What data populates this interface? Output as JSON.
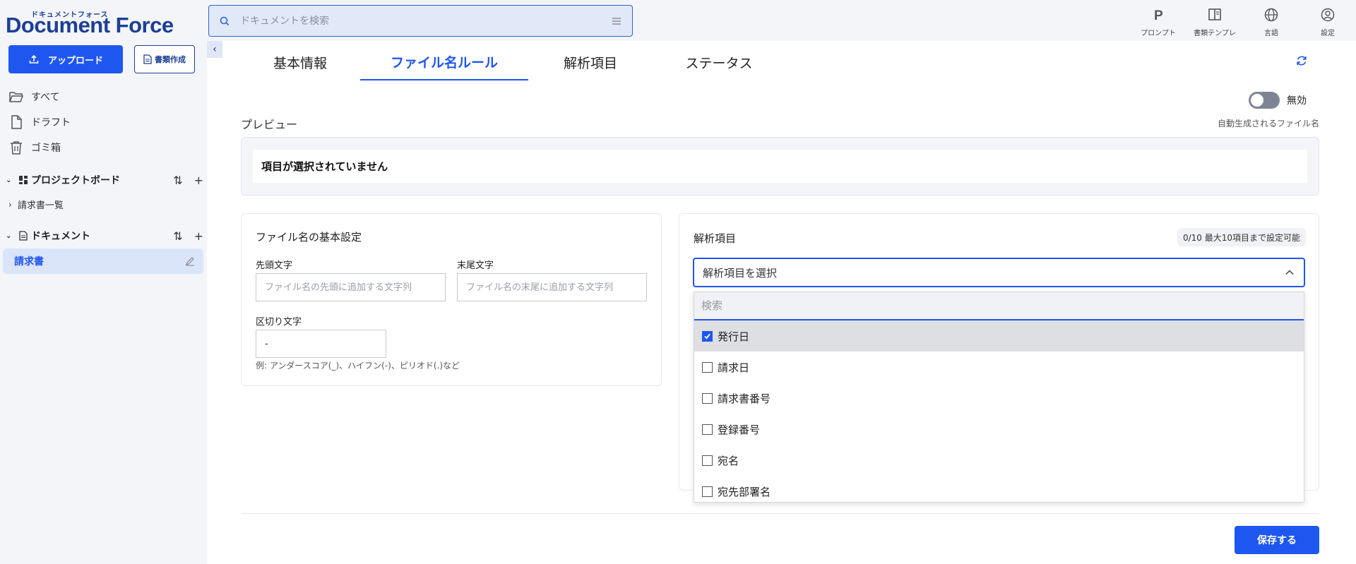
{
  "brand": {
    "sub": "ドキュメントフォース",
    "name": "Document Force",
    "color": "#1d3f95"
  },
  "search": {
    "placeholder": "ドキュメントを検索"
  },
  "top_nav": [
    {
      "label": "プロンプト",
      "icon": "prompt-icon"
    },
    {
      "label": "書類テンプレ",
      "icon": "template-icon"
    },
    {
      "label": "言語",
      "icon": "globe-icon"
    },
    {
      "label": "設定",
      "icon": "user-settings-icon"
    }
  ],
  "sidebar": {
    "upload_label": "アップロード",
    "create_label": "書類作成",
    "nav": [
      {
        "label": "すべて",
        "icon": "folder-icon"
      },
      {
        "label": "ドラフト",
        "icon": "file-icon"
      },
      {
        "label": "ゴミ箱",
        "icon": "trash-icon"
      }
    ],
    "project_board": {
      "title": "プロジェクトボード",
      "items": [
        "請求書一覧"
      ]
    },
    "documents": {
      "title": "ドキュメント",
      "selected": "請求書"
    }
  },
  "tabs": [
    {
      "label": "基本情報",
      "active": false
    },
    {
      "label": "ファイル名ルール",
      "active": true
    },
    {
      "label": "解析項目",
      "active": false
    },
    {
      "label": "ステータス",
      "active": false
    }
  ],
  "toggle": {
    "label": "無効",
    "enabled": false
  },
  "preview": {
    "title": "プレビュー",
    "auto_label": "自動生成されるファイル名",
    "empty_text": "項目が選択されていません"
  },
  "basic_settings": {
    "title": "ファイル名の基本設定",
    "prefix_label": "先頭文字",
    "prefix_placeholder": "ファイル名の先頭に追加する文字列",
    "suffix_label": "末尾文字",
    "suffix_placeholder": "ファイル名の末尾に追加する文字列",
    "separator_label": "区切り文字",
    "separator_value": "-",
    "hint": "例: アンダースコア(_)、ハイフン(-)、ピリオド(.)など"
  },
  "analysis": {
    "title": "解析項目",
    "count": "0/10 最大10項目まで設定可能",
    "select_placeholder": "解析項目を選択",
    "search_placeholder": "検索",
    "options": [
      {
        "label": "発行日",
        "checked": true
      },
      {
        "label": "請求日",
        "checked": false
      },
      {
        "label": "請求書番号",
        "checked": false
      },
      {
        "label": "登録番号",
        "checked": false
      },
      {
        "label": "宛名",
        "checked": false
      },
      {
        "label": "宛先部署名",
        "checked": false
      }
    ]
  },
  "save_label": "保存する",
  "colors": {
    "accent": "#1e56f0",
    "selected_bg": "#dbe5fa"
  }
}
